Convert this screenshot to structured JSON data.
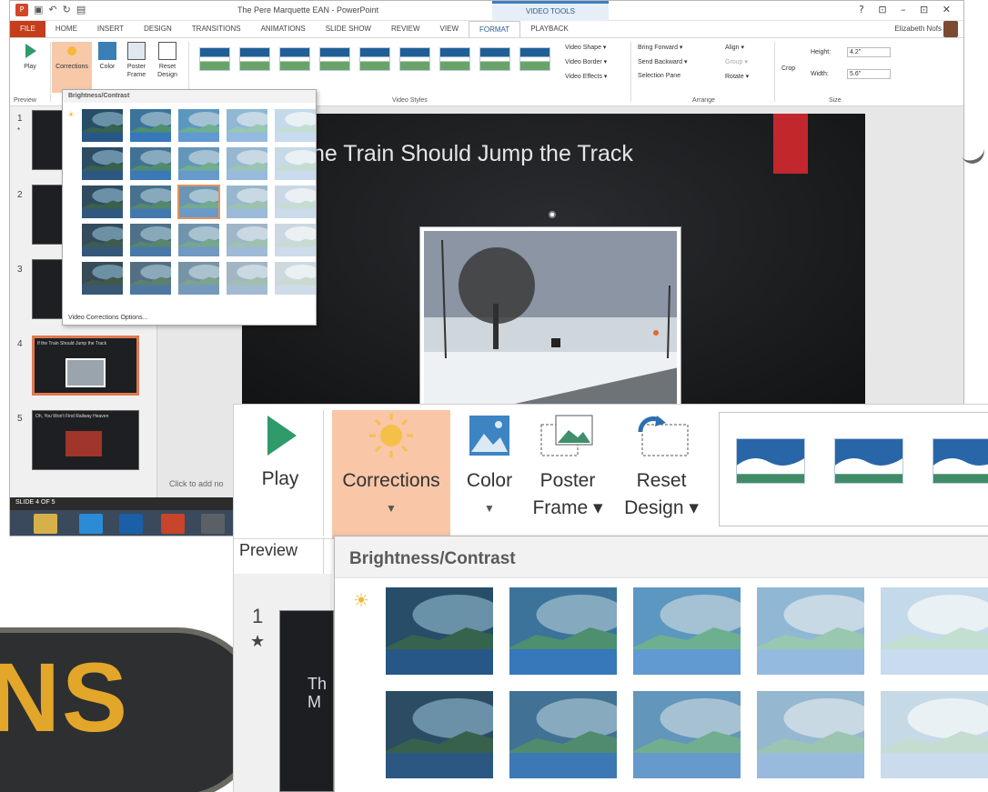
{
  "app": {
    "title": "The Pere Marquette EAN - PowerPoint",
    "context_tab_group": "VIDEO TOOLS",
    "user": "Elizabeth Nofs",
    "window_controls": "? ⊡ – ⊡ ✕"
  },
  "tabs": [
    "FILE",
    "HOME",
    "INSERT",
    "DESIGN",
    "TRANSITIONS",
    "ANIMATIONS",
    "SLIDE SHOW",
    "REVIEW",
    "VIEW",
    "FORMAT",
    "PLAYBACK"
  ],
  "active_tab": "FORMAT",
  "ribbon": {
    "play": "Play",
    "corrections": "Corrections",
    "color": "Color",
    "poster_frame": "Poster Frame",
    "poster_frame_l1": "Poster",
    "poster_frame_l2": "Frame ▾",
    "reset_design": "Reset Design",
    "reset_design_l1": "Reset",
    "reset_design_l2": "Design ▾",
    "preview_group": "Preview",
    "video_styles_group": "Video Styles",
    "arrange_group": "Arrange",
    "size_group": "Size",
    "video_shape": "Video Shape ▾",
    "video_border": "Video Border ▾",
    "video_effects": "Video Effects ▾",
    "bring_forward": "Bring Forward ▾",
    "send_backward": "Send Backward ▾",
    "selection_pane": "Selection Pane",
    "align": "Align ▾",
    "group": "Group ▾",
    "rotate": "Rotate ▾",
    "crop": "Crop",
    "height_label": "Height:",
    "height_value": "4.2\"",
    "width_label": "Width:",
    "width_value": "5.6\""
  },
  "dropdown": {
    "header": "Brightness/Contrast",
    "options_link": "Video Corrections Options..."
  },
  "slide": {
    "title": "the Train Should Jump the Track"
  },
  "thumbnails": [
    {
      "num": "1",
      "title": "Th\nM"
    },
    {
      "num": "2",
      "title": ""
    },
    {
      "num": "3",
      "title": ""
    },
    {
      "num": "4",
      "title": "If the Train Should Jump the Track"
    },
    {
      "num": "5",
      "title": "Oh, You Won't Find Railway Heaven"
    }
  ],
  "notes_placeholder": "Click to add no",
  "status": "SLIDE 4 OF 5",
  "zoom": {
    "play": "Play",
    "corrections": "Corrections",
    "color": "Color",
    "poster_l1": "Poster",
    "poster_l2": "Frame ▾",
    "reset_l1": "Reset",
    "reset_l2": "Design ▾",
    "preview": "Preview",
    "header": "Brightness/Contrast",
    "thumb_num": "1",
    "thumb_text": "Th\nM"
  },
  "sign_text": "NS",
  "colors": {
    "file_tab": "#c43e1c",
    "corrections_highlight": "#f7c9a9",
    "accent_blue": "#2a5c95",
    "slide_red": "#c1272d"
  }
}
